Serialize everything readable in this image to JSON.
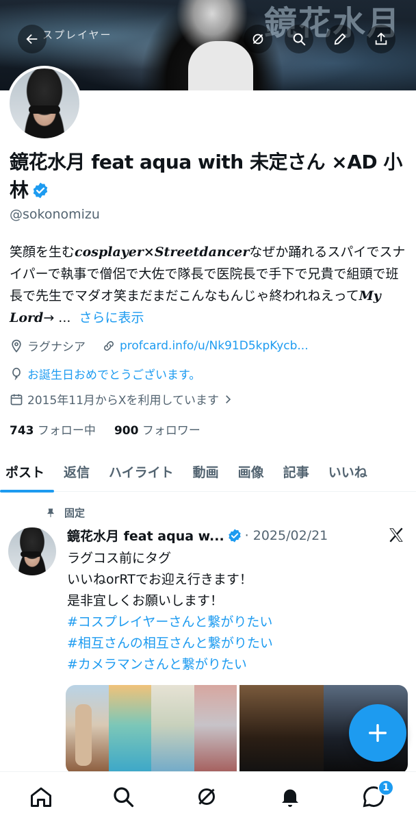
{
  "banner": {
    "title": "鏡花水月",
    "subtitle": "スプレイヤー"
  },
  "profile": {
    "display_name": "鏡花水月 feat aqua with 未定さん ×AD 小林",
    "handle": "@sokonomizu",
    "bio_part1": "笑顔を生む",
    "bio_fancy1": "cosplayer×Streetdancer",
    "bio_part2": "なぜか踊れるスパイでスナイパーで執事で僧侶で大佐で隊長で医院長で手下で兄貴で組頭で班長で先生でマダオ笑まだまだこんなもんじゃ終われねえって",
    "bio_fancy2": "My Lord",
    "bio_part3": "→ ...",
    "bio_more": "さらに表示",
    "location": "ラグナシア",
    "website": "profcard.info/u/Nk91D5kpKycb...",
    "birthday": "お誕生日おめでとうございます。",
    "joined": "2015年11月からXを利用しています",
    "following_count": "743",
    "following_label": "フォロー中",
    "followers_count": "900",
    "followers_label": "フォロワー"
  },
  "tabs": [
    {
      "label": "ポスト"
    },
    {
      "label": "返信"
    },
    {
      "label": "ハイライト"
    },
    {
      "label": "動画"
    },
    {
      "label": "画像"
    },
    {
      "label": "記事"
    },
    {
      "label": "いいね"
    }
  ],
  "post": {
    "pinned_label": "固定",
    "author": "鏡花水月 feat aqua w...",
    "date": "· 2025/02/21",
    "line1": "ラグコス前にタグ",
    "line2": "いいねorRTでお迎え行きます！",
    "line3": "是非宜しくお願いします！",
    "hashtags": [
      "#コスプレイヤーさんと繋がりたい",
      "#相互さんの相互さんと繋がりたい",
      "#カメラマンさんと繋がりたい"
    ]
  },
  "nav": {
    "badge": "1"
  },
  "colors": {
    "accent": "#1d9bf0",
    "text": "#0f1419",
    "muted": "#536471"
  }
}
